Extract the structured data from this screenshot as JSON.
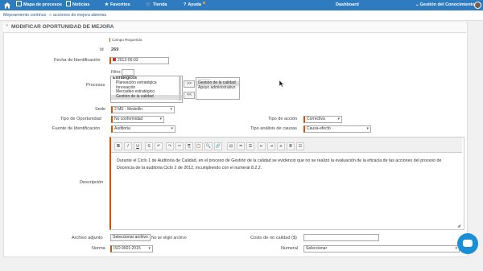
{
  "nav": {
    "items": [
      "Mapa de procesos",
      "Noticias",
      "Favoritos",
      "Tienda",
      "Ayuda",
      "Dashboard",
      "Gestión del Conocimiento"
    ]
  },
  "breadcrumb": {
    "root": "Mejoramiento continuo",
    "sep": "»",
    "current": "acciones de mejora abiertas"
  },
  "panel": {
    "title": "MODIFICAR OPORTUNIDAD DE MEJORA",
    "required_note": "Campo Requerido"
  },
  "form": {
    "id_label": "Id",
    "id_value": "269",
    "fecha_label": "Fecha de Identificación",
    "fecha_value": "2013-06-03",
    "procesos_label": "Procesos",
    "filtro_label": "Filtro:",
    "procesos_left": [
      "Estratégicos",
      "Planeación estratégica",
      "Innovación",
      "Mercadeo estratégico",
      "Gestión de la calidad"
    ],
    "procesos_right": [
      "---------",
      "Gestión de la calidad",
      "Apoyo administrativo"
    ],
    "move_right": ">>",
    "move_left": "<<",
    "sede_label": "Sede",
    "sede_value": "2 ME - Medellín",
    "tipo_oportunidad_label": "Tipo de Oportunidad",
    "tipo_oportunidad_value": "No conformidad",
    "tipo_accion_label": "Tipo de acción",
    "tipo_accion_value": "Correctiva",
    "fuente_label": "Fuente de Identificación",
    "fuente_value": "Auditoria",
    "tipo_analisis_label": "Tipo análisis de causas",
    "tipo_analisis_value": "Causa-efecto",
    "descripcion_label": "Descripción",
    "descripcion_text": "Durante el Ciclo 1 de Auditoría de Calidad, en el proceso de Gestión de la calidad se evidenció que no se realizó la evaluación de la eficacia de las acciones del proceso de Docencia de la auditoria Ciclo 2 de 2012, incumpliendo con el numeral 8.2.2.",
    "archivo_label": "Archivo adjunto",
    "archivo_button": "Seleccionar archivo",
    "archivo_status": "No se eligió archivo",
    "costo_label": "Costo de no calidad ($)",
    "norma_label": "Norma",
    "norma_value": "ISO 9001:2015",
    "numeral_label": "Numeral",
    "numeral_value": "Seleccionar"
  },
  "toolbar": [
    "B",
    "I",
    "U",
    "S",
    "↶",
    "↷",
    "✂",
    "⎘",
    "📋",
    "🔍",
    "🔗",
    "⊟",
    "≔",
    "☰",
    "⇤",
    "⇥",
    "≡",
    "≣",
    "☷"
  ],
  "colors": {
    "nav": "#2e7bbf",
    "required": "#d35400",
    "chat": "#1a8fd6"
  }
}
